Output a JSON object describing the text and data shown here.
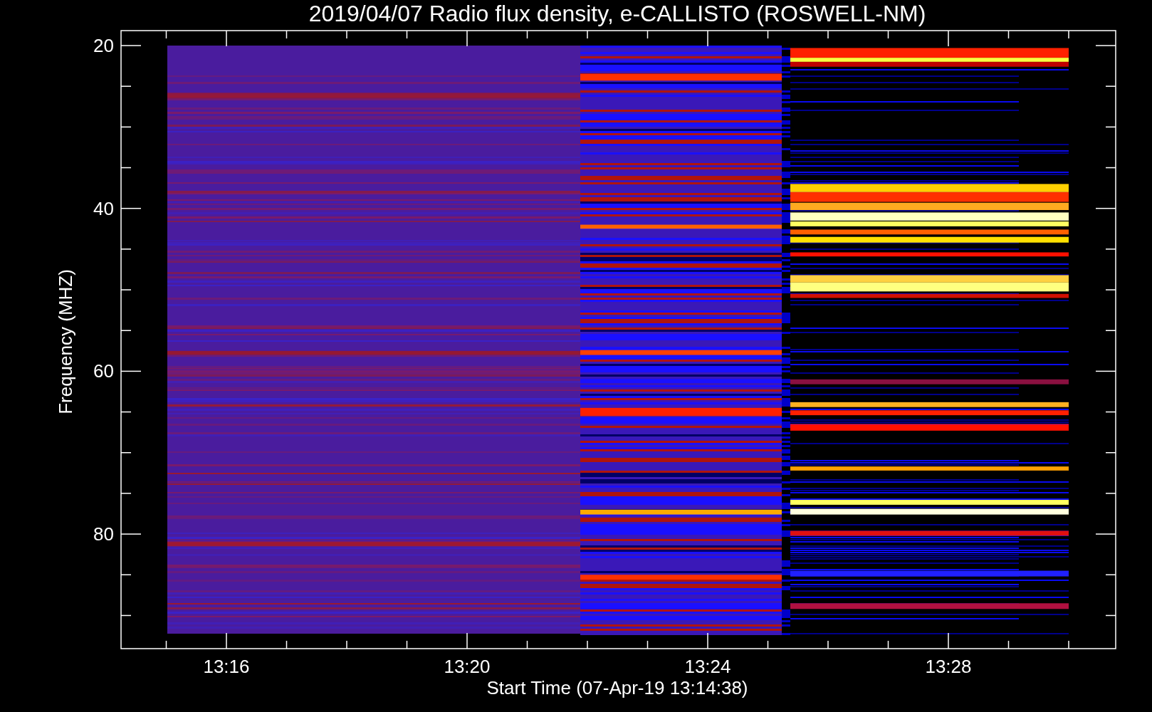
{
  "title": "2019/04/07  Radio flux density, e-CALLISTO (ROSWELL-NM)",
  "x_axis": {
    "label": "Start Time (07-Apr-19 13:14:38)",
    "ticks": [
      "13:16",
      "13:20",
      "13:24",
      "13:28"
    ]
  },
  "y_axis": {
    "label": "Frequency (MHZ)",
    "ticks": [
      "20",
      "40",
      "60",
      "80"
    ]
  }
}
